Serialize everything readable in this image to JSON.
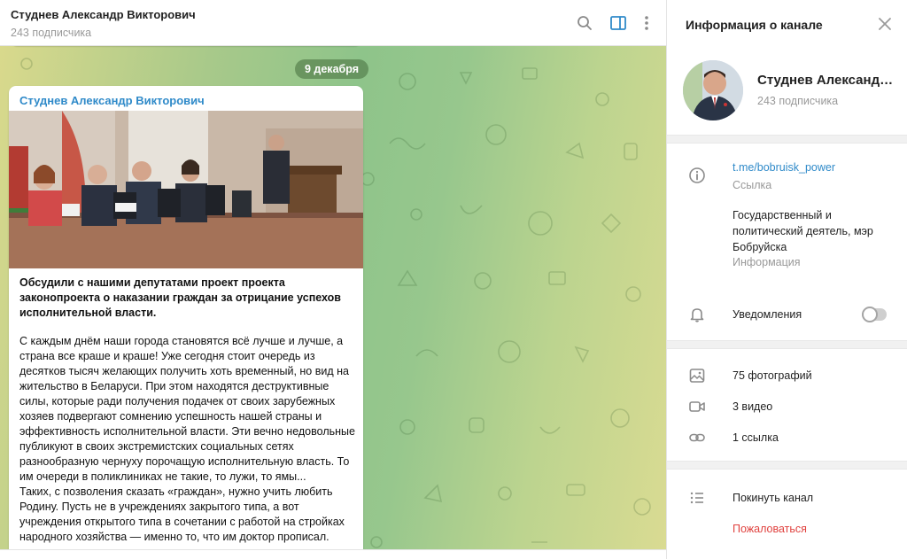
{
  "chat": {
    "title": "Студнев Александр Викторович",
    "subtitle": "243 подписчика",
    "date": "9 декабря",
    "post": {
      "author": "Студнев Александр Викторович",
      "heading": "Обсудили с нашими депутатами проект проекта законопроекта о наказании граждан за отрицание успехов исполнительной власти.",
      "body": "С каждым днём наши города становятся всё лучше и лучше, а страна все краше и краше! Уже сегодня стоит очередь из десятков тысяч желающих получить хоть временный, но вид на жительство в Беларуси. При этом находятся деструктивные силы, которые ради получения подачек от своих зарубежных хозяев подвергают сомнению успешность нашей страны и эффективность исполнительной власти. Эти вечно недовольные публикуют в своих экстремистских социальных сетях разнообразную чернуху порочащую исполнительную власть. То им очереди в поликлиниках не такие, то лужи, то ямы...\nТаких, с позволения сказать «граждан», нужно учить любить Родину. Пусть не в учреждениях закрытого типа, а вот учреждения открытого типа в сочетании с работой на стройках народного хозяйства — именно то, что им доктор прописал."
    }
  },
  "panel": {
    "title": "Информация о канале",
    "channel_name": "Студнев Александр Викторович",
    "channel_sub": "243 подписчика",
    "link": "t.me/bobruisk_power",
    "link_label": "Ссылка",
    "info": "Государственный и политический деятель, мэр Бобруйска",
    "info_label": "Информация",
    "notifications": "Уведомления",
    "notifications_on": false,
    "photos": "75 фотографий",
    "videos": "3 видео",
    "links": "1 ссылка",
    "leave": "Покинуть канал",
    "report": "Пожаловаться"
  },
  "colors": {
    "accent": "#2f8ac9",
    "danger": "#e0413e",
    "muted": "#999999"
  },
  "icons": [
    "search-icon",
    "sidebar-toggle-icon",
    "more-vert-icon",
    "close-icon",
    "info-icon",
    "bell-icon",
    "photo-icon",
    "video-icon",
    "link-icon",
    "list-icon"
  ]
}
